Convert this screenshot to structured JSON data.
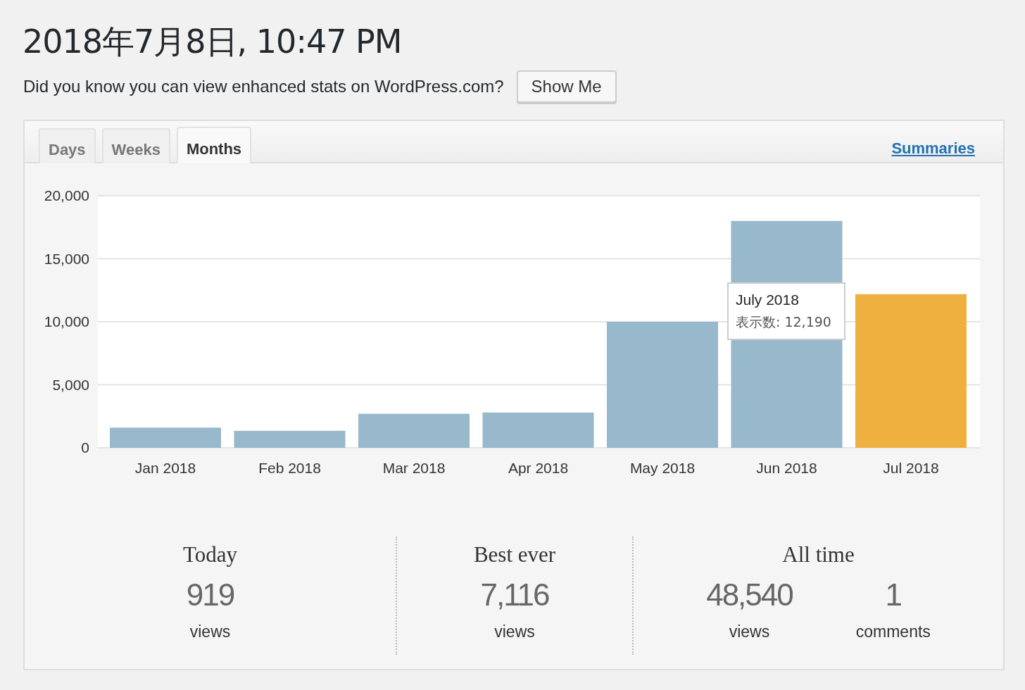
{
  "title": "2018年7月8日, 10:47 PM",
  "notice": {
    "text": "Did you know you can view enhanced stats on WordPress.com?",
    "button": "Show Me"
  },
  "tabs": [
    {
      "label": "Days",
      "selected": false
    },
    {
      "label": "Weeks",
      "selected": false
    },
    {
      "label": "Months",
      "selected": true
    }
  ],
  "summaries_link": "Summaries",
  "chart_data": {
    "type": "bar",
    "grid": true,
    "categories": [
      "Jan 2018",
      "Feb 2018",
      "Mar 2018",
      "Apr 2018",
      "May 2018",
      "Jun 2018",
      "Jul 2018"
    ],
    "series": [
      {
        "color": "#98b8cb",
        "values": [
          1600,
          1350,
          2700,
          2800,
          10000,
          18000,
          null
        ]
      },
      {
        "color": "#f0b03f",
        "values": [
          null,
          null,
          null,
          null,
          null,
          null,
          12190
        ]
      }
    ],
    "ylim": [
      0,
      20000
    ],
    "yticks": [
      {
        "value": 0,
        "label": "0"
      },
      {
        "value": 5000,
        "label": "5,000"
      },
      {
        "value": 10000,
        "label": "10,000"
      },
      {
        "value": 15000,
        "label": "15,000"
      },
      {
        "value": 20000,
        "label": "20,000"
      }
    ]
  },
  "tooltip": {
    "title": "July 2018",
    "text": "表示数: 12,190"
  },
  "stats": [
    {
      "title": "Today",
      "items": [
        {
          "value": "919",
          "label": "views"
        }
      ]
    },
    {
      "title": "Best ever",
      "items": [
        {
          "value": "7,116",
          "label": "views"
        }
      ]
    },
    {
      "title": "All time",
      "items": [
        {
          "value": "48,540",
          "label": "views"
        },
        {
          "value": "1",
          "label": "comments"
        }
      ]
    }
  ]
}
